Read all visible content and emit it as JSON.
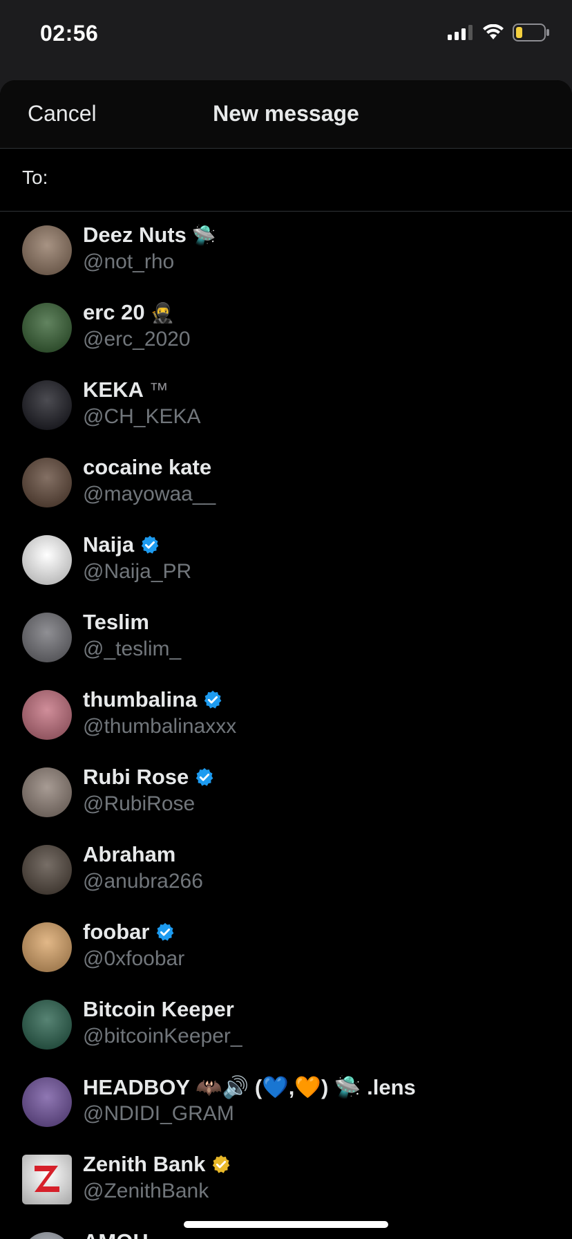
{
  "status": {
    "time": "02:56"
  },
  "header": {
    "cancel_label": "Cancel",
    "title": "New message"
  },
  "to": {
    "label": "To:",
    "value": "",
    "placeholder": ""
  },
  "contacts": [
    {
      "name": "Deez Nuts",
      "handle": "@not_rho",
      "deco": "🛸",
      "badge": "",
      "avatar_color": "#8a6f5a"
    },
    {
      "name": "erc 20",
      "handle": "@erc_2020",
      "deco": "🥷",
      "badge": "",
      "avatar_color": "#2d5a2a"
    },
    {
      "name": "KEKA",
      "handle": "@CH_KEKA",
      "deco": "™",
      "badge": "",
      "avatar_color": "#101018"
    },
    {
      "name": "cocaine kate",
      "handle": "@mayowaa__",
      "deco": "",
      "badge": "",
      "avatar_color": "#5a4030"
    },
    {
      "name": "Naija",
      "handle": "@Naija_PR",
      "deco": "",
      "badge": "blue",
      "avatar_color": "#ffffff"
    },
    {
      "name": "Teslim",
      "handle": "@_teslim_",
      "deco": "",
      "badge": "",
      "avatar_color": "#6a6a70"
    },
    {
      "name": "thumbalina",
      "handle": "@thumbalinaxxx",
      "deco": "",
      "badge": "blue",
      "avatar_color": "#c06878"
    },
    {
      "name": "Rubi Rose",
      "handle": "@RubiRose",
      "deco": "",
      "badge": "blue",
      "avatar_color": "#8a7a70"
    },
    {
      "name": "Abraham",
      "handle": "@anubra266",
      "deco": "",
      "badge": "",
      "avatar_color": "#4a3e34"
    },
    {
      "name": "foobar",
      "handle": "@0xfoobar",
      "deco": "",
      "badge": "blue",
      "avatar_color": "#d8a060"
    },
    {
      "name": "Bitcoin Keeper",
      "handle": "@bitcoinKeeper_",
      "deco": "",
      "badge": "",
      "avatar_color": "#1f5a45"
    },
    {
      "name": "HEADBOY",
      "handle": "@NDIDI_GRAM",
      "deco": "🦇🔊 (💙,🧡) 🛸 .lens",
      "badge": "",
      "avatar_color": "#6a4a9a"
    },
    {
      "name": "Zenith Bank",
      "handle": "@ZenithBank",
      "deco": "",
      "badge": "gold",
      "avatar_color": "#ffffff"
    },
    {
      "name": "AMOH",
      "handle": "",
      "deco": "",
      "badge": "",
      "avatar_color": "#9aa0aa"
    }
  ],
  "colors": {
    "verified_blue": "#1d9bf0",
    "verified_gold": "#e8b829",
    "handle_gray": "#71767b"
  }
}
